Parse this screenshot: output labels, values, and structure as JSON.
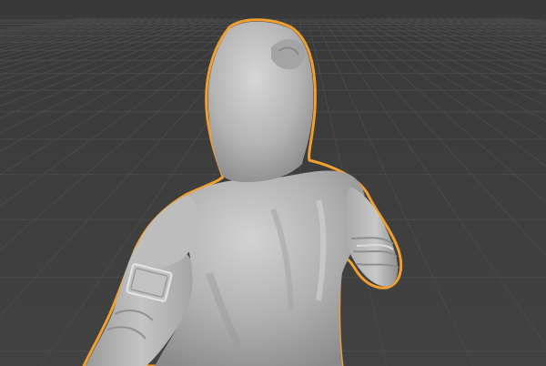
{
  "viewport": {
    "background_color": "#3d3d3d",
    "grid_color": "#4a4a4a",
    "selection_outline_color": "#f0a030",
    "object": {
      "name": "",
      "shading": "solid-gray",
      "selected": true,
      "base_color": "#b6b6b6",
      "highlight_color": "#d8d8d8",
      "shadow_color": "#7a7a7a"
    }
  }
}
